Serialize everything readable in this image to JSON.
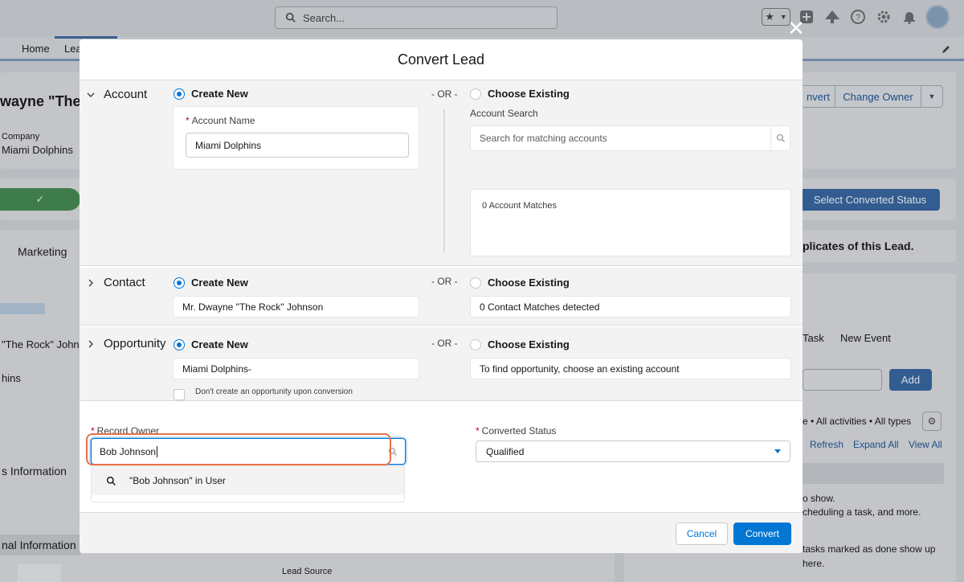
{
  "background": {
    "search_placeholder": "Search...",
    "nav": {
      "home": "Home",
      "leads": "Lea"
    },
    "record_title_fragment": "wayne \"The I",
    "company_label": "Company",
    "company_value": "Miami Dolphins",
    "convert_btn_fragment": "nvert",
    "change_owner_label": "Change Owner",
    "select_status_label": "Select Converted Status",
    "marketing_tab": "Marketing",
    "duplicates_fragment": "plicates of this Lead.",
    "task_tab_fragment": "Task",
    "new_event_tab": "New Event",
    "add_button": "Add",
    "filter_text": "e • All activities • All types",
    "refresh_link": "Refresh",
    "expand_all_link": "Expand All",
    "view_all_link": "View All",
    "rock_fragment": "\"The Rock\" John",
    "hins_fragment": "hins",
    "info_fragment": "s Information",
    "nothing_show_fragment": "o show.",
    "scheduling_fragment": "cheduling a task, and more.",
    "additional_info_fragment": "nal Information",
    "tasks_done_fragment": "tasks marked as done show up",
    "here_fragment": "here.",
    "lead_source_label": "Lead Source"
  },
  "modal": {
    "title": "Convert Lead",
    "or_text": "- OR -",
    "create_new": "Create New",
    "choose_existing": "Choose Existing",
    "account": {
      "section_label": "Account",
      "name_label": "Account Name",
      "name_value": "Miami Dolphins",
      "search_label": "Account Search",
      "search_placeholder": "Search for matching accounts",
      "matches_text": "0 Account Matches"
    },
    "contact": {
      "section_label": "Contact",
      "new_value": "Mr. Dwayne \"The Rock\" Johnson",
      "matches_text": "0 Contact Matches detected"
    },
    "opportunity": {
      "section_label": "Opportunity",
      "new_value": "Miami Dolphins-",
      "existing_hint": "To find opportunity, choose an existing account",
      "no_opp_label": "Don't create an opportunity upon conversion"
    },
    "record_owner": {
      "label": "Record Owner",
      "value": "Bob Johnson",
      "suggestion": "\"Bob Johnson\" in User"
    },
    "converted_status": {
      "label": "Converted Status",
      "value": "Qualified"
    },
    "buttons": {
      "cancel": "Cancel",
      "convert": "Convert"
    }
  },
  "colors": {
    "brand": "#0176d3",
    "required": "#ba0517",
    "highlight": "#e8704a"
  }
}
